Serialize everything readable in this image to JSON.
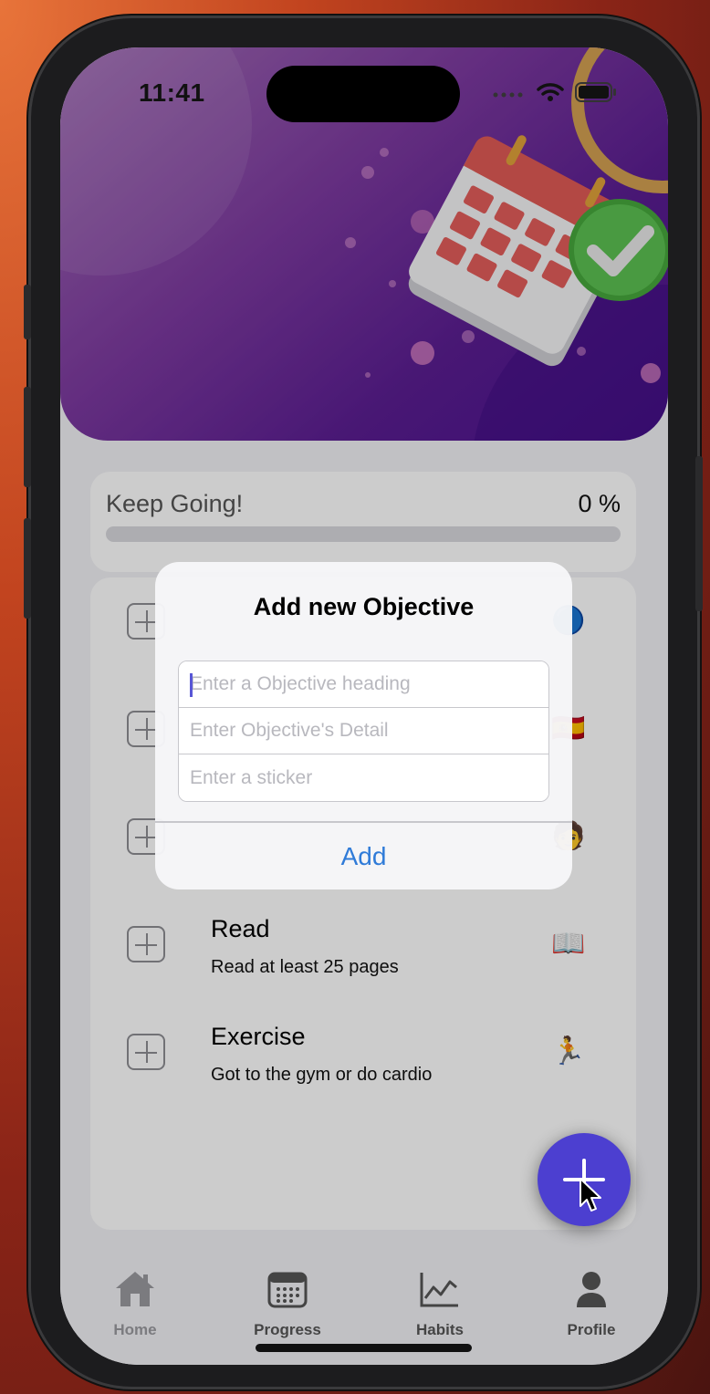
{
  "status_bar": {
    "time": "11:41"
  },
  "progress": {
    "label": "Keep Going!",
    "percent": "0 %",
    "fraction": 0
  },
  "objectives": [
    {
      "title": "Read",
      "detail": "Read at least 25 pages",
      "sticker": "📖"
    },
    {
      "title": "Exercise",
      "detail": "Got to the gym or do cardio",
      "sticker": "🏃"
    }
  ],
  "dialog": {
    "title": "Add new Objective",
    "heading_placeholder": "Enter a Objective heading",
    "detail_placeholder": "Enter Objective's Detail",
    "sticker_placeholder": "Enter a sticker",
    "add_label": "Add"
  },
  "tabs": [
    {
      "label": "Home",
      "icon": "house-icon",
      "active": true
    },
    {
      "label": "Progress",
      "icon": "calendar-icon",
      "active": false
    },
    {
      "label": "Habits",
      "icon": "chart-icon",
      "active": false
    },
    {
      "label": "Profile",
      "icon": "person-icon",
      "active": false
    }
  ],
  "colors": {
    "hero_purple": "#5a1d92",
    "accent_blue": "#2f7bd8",
    "fab": "#4c3fd0"
  }
}
